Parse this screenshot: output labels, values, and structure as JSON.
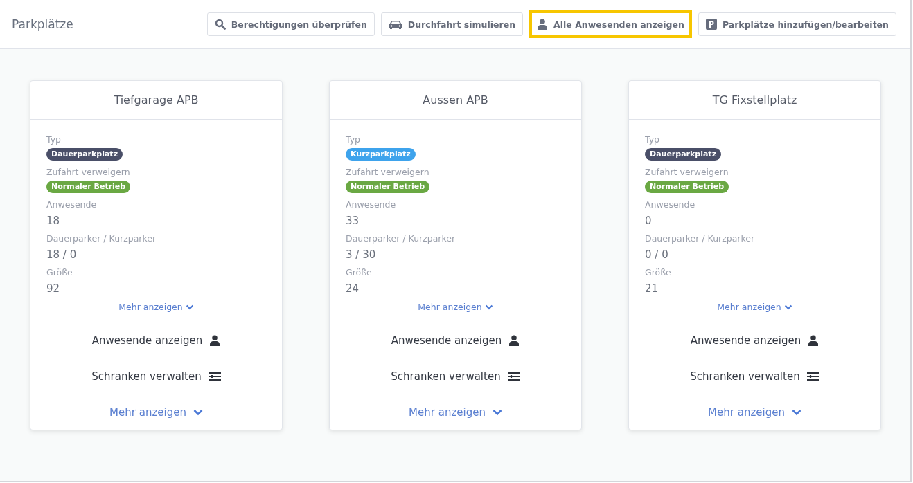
{
  "header": {
    "title": "Parkplätze",
    "buttons": [
      {
        "kind": "search",
        "label": "Berechtigungen überprüfen",
        "highlighted": false
      },
      {
        "kind": "car",
        "label": "Durchfahrt simulieren",
        "highlighted": false
      },
      {
        "kind": "person",
        "label": "Alle Anwesenden anzeigen",
        "highlighted": true
      },
      {
        "kind": "parking",
        "label": "Parkplätze hinzufügen/bearbeiten",
        "highlighted": false
      }
    ]
  },
  "cards": [
    {
      "title": "Tiefgarage APB",
      "fields": [
        {
          "label": "Typ",
          "badge": "Dauerparkplatz",
          "color": "#4a4f68"
        },
        {
          "label": "Zufahrt verweigern",
          "badge": "Normaler Betrieb",
          "color": "#6aa843"
        },
        {
          "label": "Anwesende",
          "value": "18"
        },
        {
          "label": "Dauerparker / Kurzparker",
          "value": "18 / 0"
        },
        {
          "label": "Größe",
          "value": "92"
        }
      ],
      "more_link": "Mehr anzeigen",
      "actions": [
        {
          "kind": "person",
          "label": "Anwesende anzeigen"
        },
        {
          "kind": "sliders",
          "label": "Schranken verwalten"
        },
        {
          "kind": "more",
          "label": "Mehr anzeigen"
        }
      ]
    },
    {
      "title": "Aussen APB",
      "fields": [
        {
          "label": "Typ",
          "badge": "Kurzparkplatz",
          "color": "#3ea3ec"
        },
        {
          "label": "Zufahrt verweigern",
          "badge": "Normaler Betrieb",
          "color": "#6aa843"
        },
        {
          "label": "Anwesende",
          "value": "33"
        },
        {
          "label": "Dauerparker / Kurzparker",
          "value": "3 / 30"
        },
        {
          "label": "Größe",
          "value": "24"
        }
      ],
      "more_link": "Mehr anzeigen",
      "actions": [
        {
          "kind": "person",
          "label": "Anwesende anzeigen"
        },
        {
          "kind": "sliders",
          "label": "Schranken verwalten"
        },
        {
          "kind": "more",
          "label": "Mehr anzeigen"
        }
      ]
    },
    {
      "title": "TG Fixstellplatz",
      "fields": [
        {
          "label": "Typ",
          "badge": "Dauerparkplatz",
          "color": "#4a4f68"
        },
        {
          "label": "Zufahrt verweigern",
          "badge": "Normaler Betrieb",
          "color": "#6aa843"
        },
        {
          "label": "Anwesende",
          "value": "0"
        },
        {
          "label": "Dauerparker / Kurzparker",
          "value": "0 / 0"
        },
        {
          "label": "Größe",
          "value": "21"
        }
      ],
      "more_link": "Mehr anzeigen",
      "actions": [
        {
          "kind": "person",
          "label": "Anwesende anzeigen"
        },
        {
          "kind": "sliders",
          "label": "Schranken verwalten"
        },
        {
          "kind": "more",
          "label": "Mehr anzeigen"
        }
      ]
    }
  ]
}
